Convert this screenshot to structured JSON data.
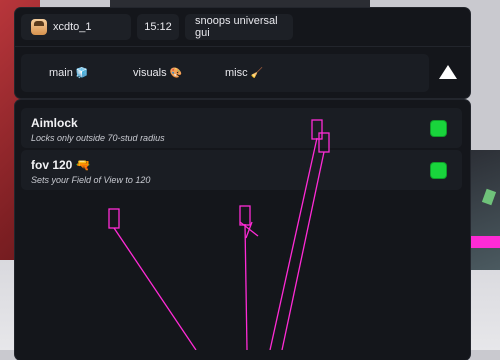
{
  "header": {
    "username": "xcdto_1",
    "time": "15:12",
    "title": "snoops universal gui"
  },
  "tabs": [
    {
      "label": "main",
      "icon": "🧊"
    },
    {
      "label": "visuals",
      "icon": "🎨"
    },
    {
      "label": "misc",
      "icon": "🧹"
    }
  ],
  "options": [
    {
      "title": "Aimlock",
      "description": "Locks only outside 70-stud radius",
      "enabled": true
    },
    {
      "title": "fov 120 🔫",
      "description": "Sets your Field of View to 120",
      "enabled": true
    }
  ],
  "colors": {
    "panel_bg": "#14161b",
    "toggle_on": "#19d43c",
    "esp": "#ff2bd6"
  }
}
